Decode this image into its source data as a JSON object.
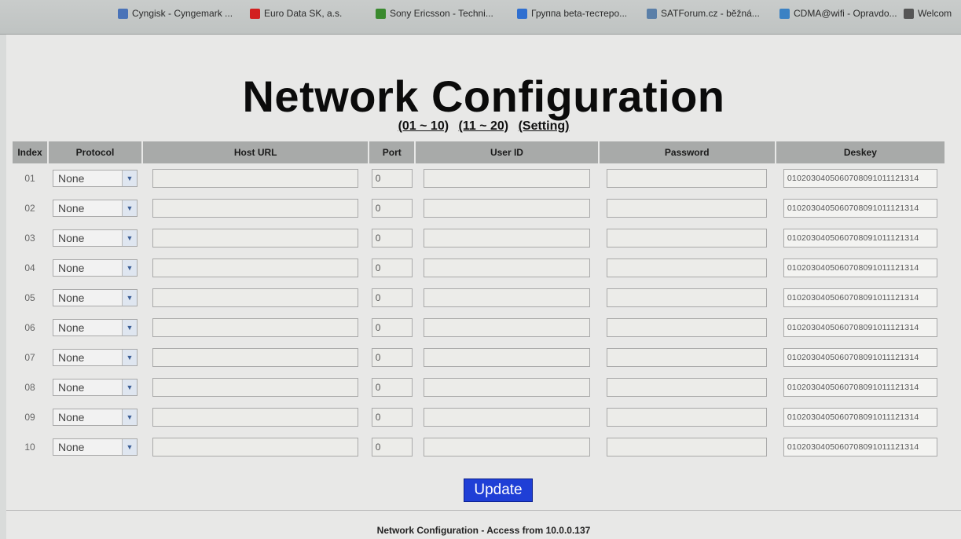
{
  "bookmarks": [
    {
      "label": "Cyngisk - Cyngemark ...",
      "color": "#4a73b8"
    },
    {
      "label": "Euro Data SK, a.s.",
      "color": "#d22020"
    },
    {
      "label": "Sony Ericsson - Techni...",
      "color": "#3a8a2e"
    },
    {
      "label": "Группа beta-тестеро...",
      "color": "#2f6fd0"
    },
    {
      "label": "SATForum.cz - běžná...",
      "color": "#5a7fa8"
    },
    {
      "label": "CDMA@wifi - Opravdo...",
      "color": "#3b82c4"
    },
    {
      "label": "Welcom",
      "color": "#555555"
    }
  ],
  "title": "Network Configuration",
  "ranges": [
    "(01 ~ 10)",
    "(11 ~ 20)",
    "(Setting)"
  ],
  "columns": {
    "index": "Index",
    "protocol": "Protocol",
    "host_url": "Host URL",
    "port": "Port",
    "user_id": "User ID",
    "password": "Password",
    "deskey": "Deskey"
  },
  "rows": [
    {
      "index": "01",
      "protocol": "None",
      "host": "",
      "port": "0",
      "user": "",
      "password": "",
      "deskey": "0102030405060708091011121314"
    },
    {
      "index": "02",
      "protocol": "None",
      "host": "",
      "port": "0",
      "user": "",
      "password": "",
      "deskey": "0102030405060708091011121314"
    },
    {
      "index": "03",
      "protocol": "None",
      "host": "",
      "port": "0",
      "user": "",
      "password": "",
      "deskey": "0102030405060708091011121314"
    },
    {
      "index": "04",
      "protocol": "None",
      "host": "",
      "port": "0",
      "user": "",
      "password": "",
      "deskey": "0102030405060708091011121314"
    },
    {
      "index": "05",
      "protocol": "None",
      "host": "",
      "port": "0",
      "user": "",
      "password": "",
      "deskey": "0102030405060708091011121314"
    },
    {
      "index": "06",
      "protocol": "None",
      "host": "",
      "port": "0",
      "user": "",
      "password": "",
      "deskey": "0102030405060708091011121314"
    },
    {
      "index": "07",
      "protocol": "None",
      "host": "",
      "port": "0",
      "user": "",
      "password": "",
      "deskey": "0102030405060708091011121314"
    },
    {
      "index": "08",
      "protocol": "None",
      "host": "",
      "port": "0",
      "user": "",
      "password": "",
      "deskey": "0102030405060708091011121314"
    },
    {
      "index": "09",
      "protocol": "None",
      "host": "",
      "port": "0",
      "user": "",
      "password": "",
      "deskey": "0102030405060708091011121314"
    },
    {
      "index": "10",
      "protocol": "None",
      "host": "",
      "port": "0",
      "user": "",
      "password": "",
      "deskey": "0102030405060708091011121314"
    }
  ],
  "update_label": "Update",
  "footer": "Network Configuration - Access from 10.0.0.137",
  "colors": {
    "accent": "#1f3fd6",
    "header_bg": "#a8aaa9"
  }
}
